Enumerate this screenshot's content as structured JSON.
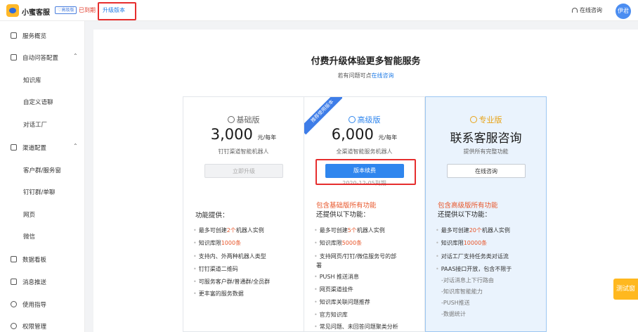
{
  "header": {
    "brand": "小蜜客服",
    "badge": "♡高级版",
    "expired": "已到期",
    "upgrade": "升级版本",
    "consult": "在线咨询",
    "avatar": "伊君"
  },
  "sidebar": {
    "items": [
      {
        "label": "服务概览",
        "icon": "home-icon"
      },
      {
        "label": "自动问答配置",
        "icon": "chat-icon",
        "chevron": "⌃"
      },
      {
        "label": "知识库"
      },
      {
        "label": "自定义语聊"
      },
      {
        "label": "对话工厂"
      },
      {
        "label": "渠道配置",
        "icon": "sliders-icon",
        "chevron": "⌃"
      },
      {
        "label": "客户群/服务窗"
      },
      {
        "label": "钉钉群/单聊"
      },
      {
        "label": "网页"
      },
      {
        "label": "微信"
      },
      {
        "label": "数据看板",
        "icon": "chart-icon"
      },
      {
        "label": "消息推送",
        "icon": "message-icon"
      },
      {
        "label": "使用指导",
        "icon": "info-icon"
      },
      {
        "label": "权限管理",
        "icon": "gear-icon"
      }
    ]
  },
  "main": {
    "title": "付费升级体验更多智能服务",
    "subtitle_prefix": "若有问题可点",
    "subtitle_link": "在线咨询"
  },
  "plans": {
    "basic": {
      "name": "基础版",
      "price": "3,000",
      "unit": "元/每年",
      "desc": "钉钉渠道智能机器人",
      "button": "立即升级",
      "feat_head": "功能提供：",
      "features": [
        {
          "pre": "最多可创建",
          "hl": "2个",
          "post": "机器人实例"
        },
        {
          "pre": "知识库限",
          "hl": "1000条",
          "post": ""
        },
        {
          "pre": "支持内、外两种机器人类型",
          "hl": "",
          "post": ""
        },
        {
          "pre": "钉钉渠道二维码",
          "hl": "",
          "post": ""
        },
        {
          "pre": "可服务客户群/普通群/全员群",
          "hl": "",
          "post": ""
        },
        {
          "pre": "更丰富的服务数据",
          "hl": "",
          "post": ""
        }
      ]
    },
    "advanced": {
      "ribbon": "推荐使用版本",
      "name": "高级版",
      "price": "6,000",
      "unit": "元/每年",
      "desc": "全渠道智能服务机器人",
      "button": "版本续费",
      "expire": "2020-12-05到期",
      "feat_head_red": "包含基础版所有功能",
      "feat_head": "还提供以下功能：",
      "features": [
        {
          "pre": "最多可创建",
          "hl": "5个",
          "post": "机器人实例"
        },
        {
          "pre": "知识库限",
          "hl": "5000条",
          "post": ""
        },
        {
          "pre": "支持网页/钉钉/微信服务号的部",
          "hl": "",
          "post": ""
        },
        {
          "pre": "署",
          "hl": "",
          "post": ""
        },
        {
          "pre": "PUSH 推送消息",
          "hl": "",
          "post": ""
        },
        {
          "pre": "网页渠道挂件",
          "hl": "",
          "post": ""
        },
        {
          "pre": "知识库关联问题推荐",
          "hl": "",
          "post": ""
        },
        {
          "pre": "官方知识库",
          "hl": "",
          "post": ""
        },
        {
          "pre": "常见问题、未回答问题聚类分析",
          "hl": "",
          "post": ""
        }
      ]
    },
    "pro": {
      "name": "专业版",
      "big": "联系客服咨询",
      "desc": "提供所有完整功能",
      "button": "在线咨询",
      "feat_head_red": "包含高级版所有功能",
      "feat_head": "还提供以下功能：",
      "features": [
        {
          "pre": "最多可创建",
          "hl": "20个",
          "post": "机器人实例"
        },
        {
          "pre": "知识库限",
          "hl": "10000条",
          "post": ""
        },
        {
          "pre": "对话工厂支持任务类对话流",
          "hl": "",
          "post": ""
        },
        {
          "pre": "PAAS接口开放，包含不限于",
          "hl": "",
          "post": ""
        }
      ],
      "sub_features": [
        "-对话消息上下行路由",
        "-知识库智能能力",
        "-PUSH推送",
        "-数据统计"
      ]
    }
  },
  "test_button": "测试窗",
  "colors": {
    "accent": "#2f86ee",
    "highlight": "#e8562a",
    "annotation": "#e62e2e"
  }
}
